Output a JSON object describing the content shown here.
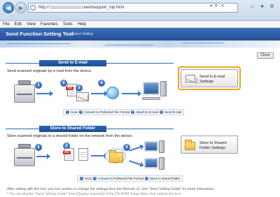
{
  "browser": {
    "url_prefix": "http://",
    "url_suffix": "/sendsupport_top.html",
    "menu": [
      "File",
      "Edit",
      "View",
      "Favorites",
      "Tools",
      "Help"
    ]
  },
  "header": {
    "title": "Send Function Setting Tool",
    "subtitle": "Select Setting"
  },
  "close_label": "Close",
  "email": {
    "heading": "Send to E-mail",
    "description": "Send scanned originals by e-mail from the device.",
    "button_label": "Send to E-mail Settings",
    "pdf_label": "PDF",
    "steps": [
      "Scan",
      "Convert to Preferred File Format",
      "Attach to E-mail",
      "Send E-mail"
    ],
    "numbers": [
      "1",
      "2",
      "3",
      "4"
    ]
  },
  "folder": {
    "heading": "Store to Shared Folder",
    "description": "Store scanned originals to a shared folder on the network from the device.",
    "button_label": "Store to Shared Folder Settings",
    "pdf_label": "PDF",
    "steps": [
      "Scan",
      "Convert to Preferred File Format",
      "Store to shared folder"
    ],
    "numbers": [
      "1",
      "2",
      "3"
    ]
  },
  "footer": {
    "line1": "After setting with this tool, you can confirm or change the settings from the Remote UI. See \"Send Setting Guide\" for more information.",
    "line2": "* You can display \"Send Setting Guide\" from [Display manuals] of the CD-ROM Setup Menu that started this tool."
  }
}
